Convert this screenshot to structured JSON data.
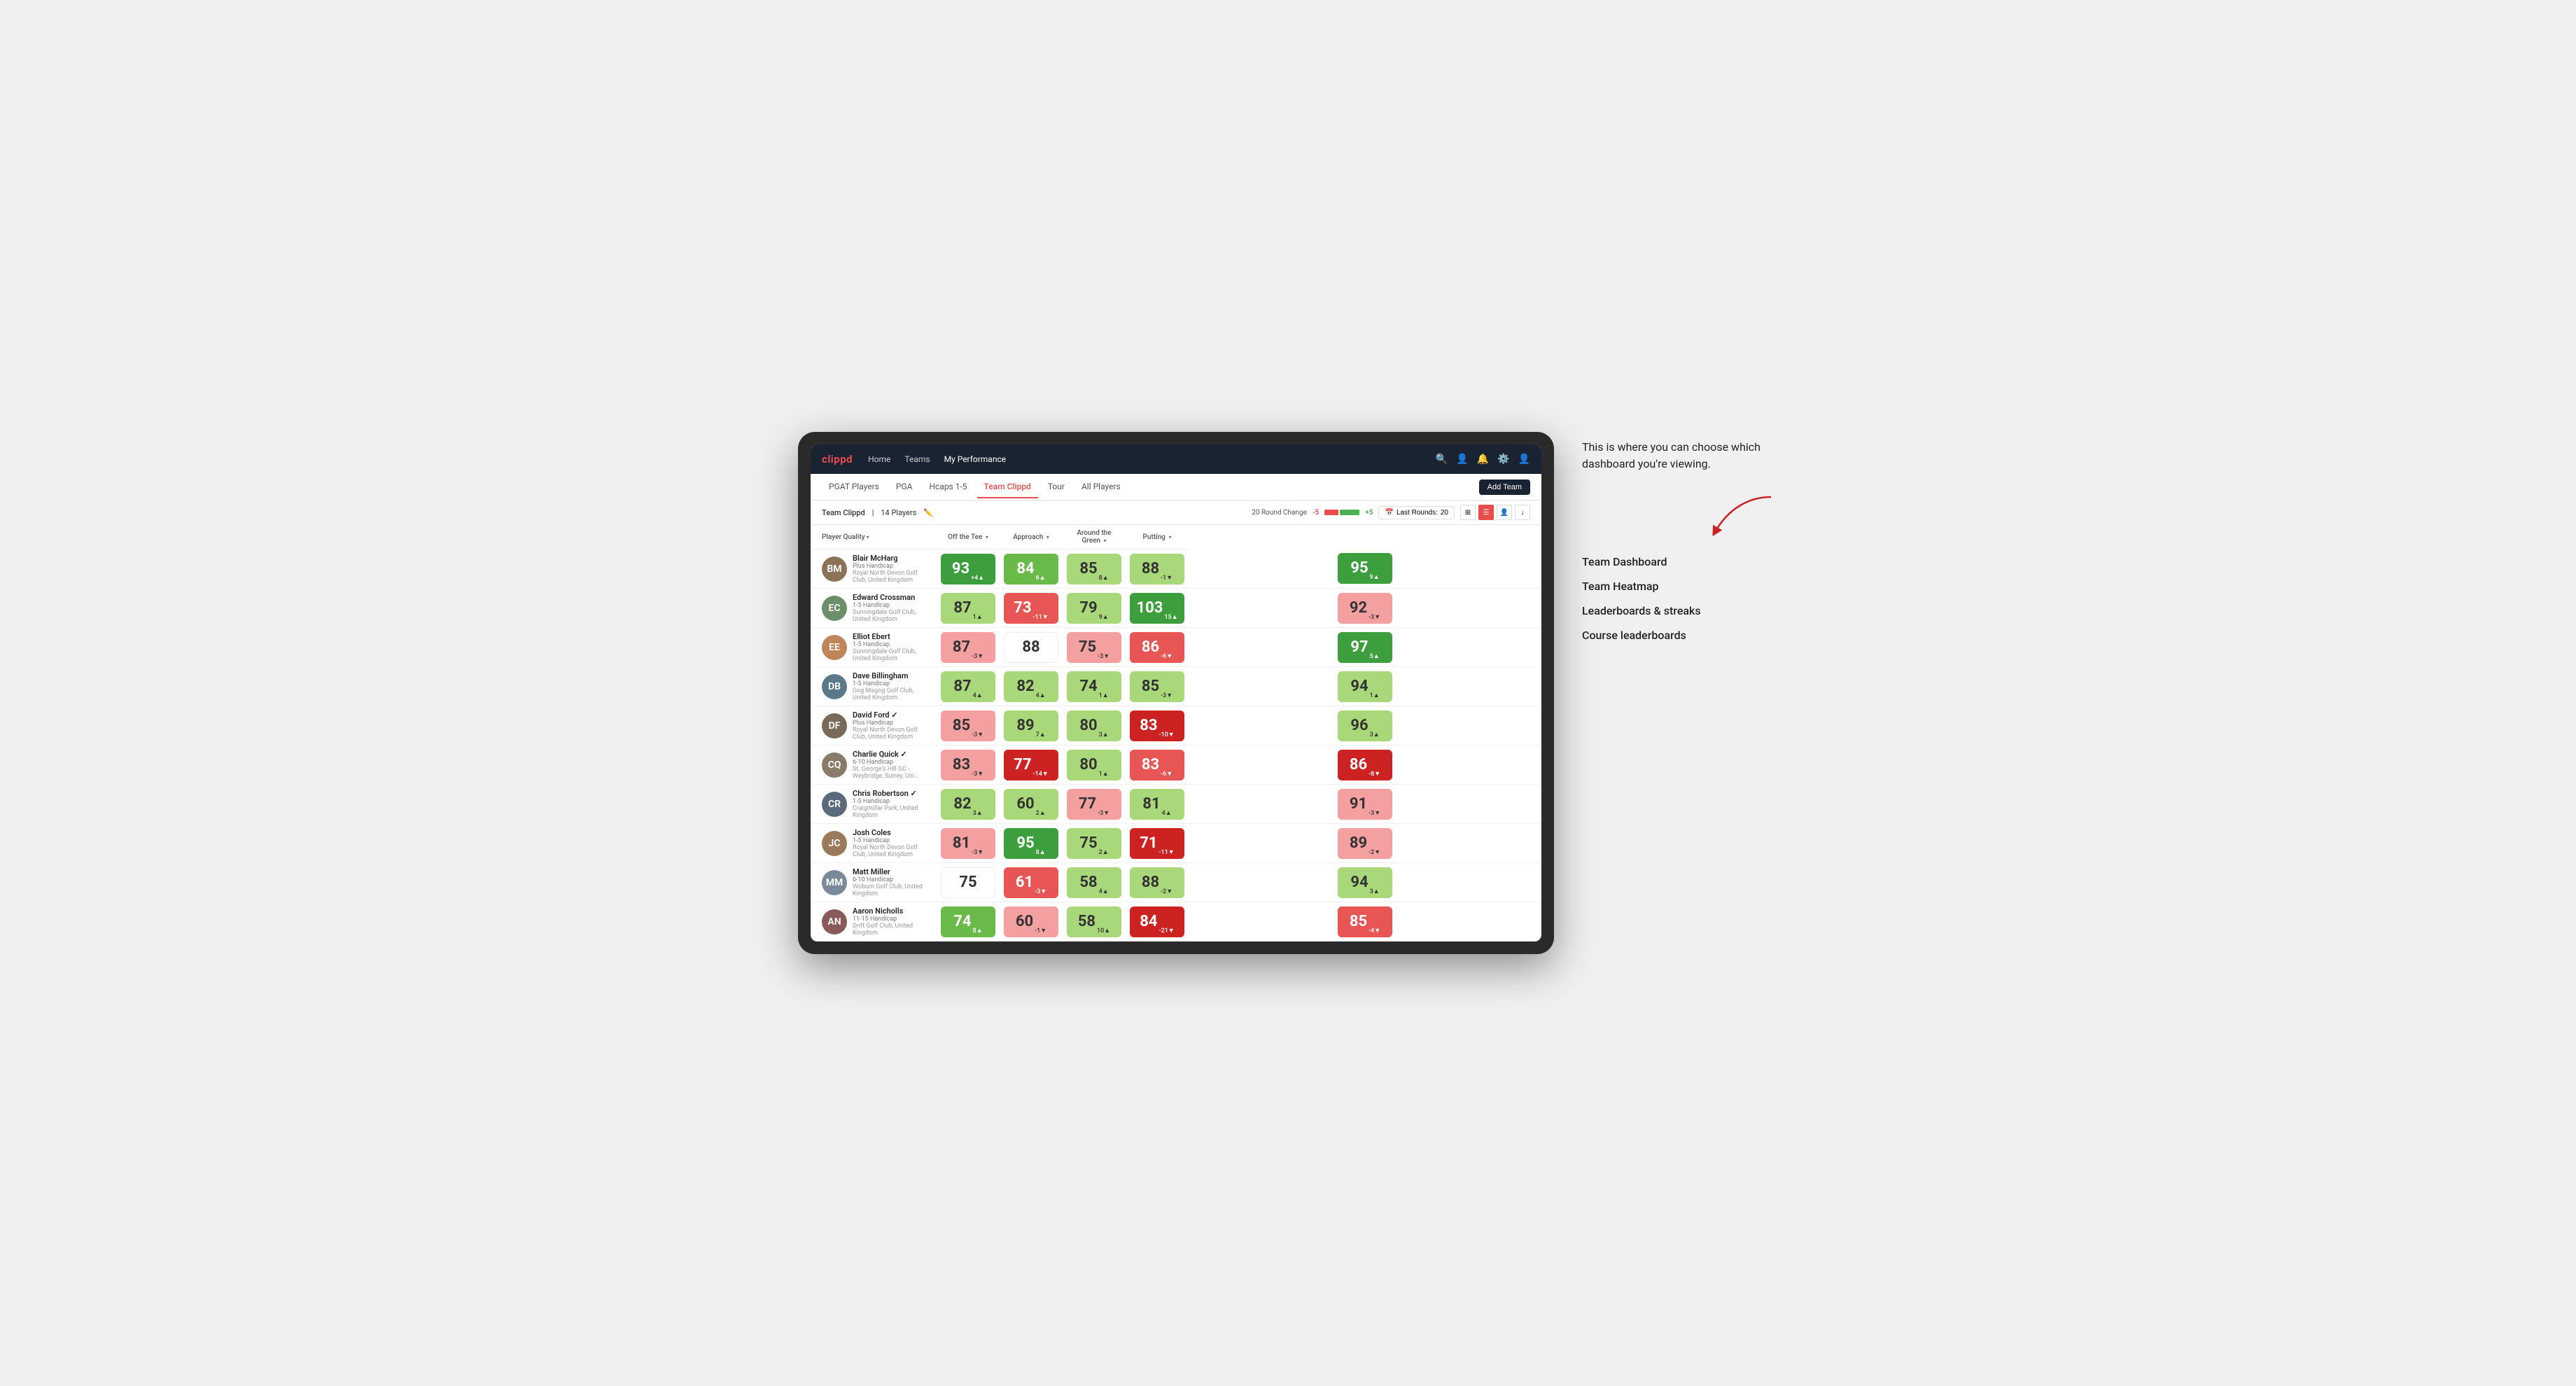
{
  "annotation": {
    "description": "This is where you can choose which dashboard you're viewing.",
    "options": [
      "Team Dashboard",
      "Team Heatmap",
      "Leaderboards & streaks",
      "Course leaderboards"
    ]
  },
  "nav": {
    "logo": "clippd",
    "links": [
      "Home",
      "Teams",
      "My Performance"
    ],
    "active_link": "My Performance"
  },
  "sub_nav": {
    "links": [
      "PGAT Players",
      "PGA",
      "Hcaps 1-5",
      "Team Clippd",
      "Tour",
      "All Players"
    ],
    "active": "Team Clippd",
    "add_team_label": "Add Team"
  },
  "team_header": {
    "name": "Team Clippd",
    "separator": "|",
    "player_count": "14 Players",
    "round_change_label": "20 Round Change",
    "change_minus": "-5",
    "change_plus": "+5",
    "last_rounds_label": "Last Rounds:",
    "last_rounds_value": "20"
  },
  "table": {
    "col_headers": [
      {
        "label": "Player Quality",
        "sortable": true
      },
      {
        "label": "Off the Tee",
        "sortable": true
      },
      {
        "label": "Approach",
        "sortable": true
      },
      {
        "label": "Around the Green",
        "sortable": true
      },
      {
        "label": "Putting",
        "sortable": true
      }
    ],
    "players": [
      {
        "name": "Blair McHarg",
        "handicap": "Plus Handicap",
        "club": "Royal North Devon Golf Club, United Kingdom",
        "avatar_color": "#8B7355",
        "initials": "BM",
        "scores": [
          {
            "value": 93,
            "change": "+4",
            "dir": "up",
            "color": "bg-green-dark"
          },
          {
            "value": 84,
            "change": "6",
            "dir": "up",
            "color": "bg-green-mid"
          },
          {
            "value": 85,
            "change": "8",
            "dir": "up",
            "color": "bg-green-light"
          },
          {
            "value": 88,
            "change": "-1",
            "dir": "down",
            "color": "bg-green-light"
          },
          {
            "value": 95,
            "change": "9",
            "dir": "up",
            "color": "bg-green-dark"
          }
        ]
      },
      {
        "name": "Edward Crossman",
        "handicap": "1-5 Handicap",
        "club": "Sunningdale Golf Club, United Kingdom",
        "avatar_color": "#6B8E6B",
        "initials": "EC",
        "scores": [
          {
            "value": 87,
            "change": "1",
            "dir": "up",
            "color": "bg-green-light"
          },
          {
            "value": 73,
            "change": "-11",
            "dir": "down",
            "color": "bg-red-mid"
          },
          {
            "value": 79,
            "change": "9",
            "dir": "up",
            "color": "bg-green-light"
          },
          {
            "value": 103,
            "change": "15",
            "dir": "up",
            "color": "bg-green-dark"
          },
          {
            "value": 92,
            "change": "-3",
            "dir": "down",
            "color": "bg-red-light"
          }
        ]
      },
      {
        "name": "Elliot Ebert",
        "handicap": "1-5 Handicap",
        "club": "Sunningdale Golf Club, United Kingdom",
        "avatar_color": "#c0855a",
        "initials": "EE",
        "scores": [
          {
            "value": 87,
            "change": "-3",
            "dir": "down",
            "color": "bg-red-light"
          },
          {
            "value": 88,
            "change": "",
            "dir": "",
            "color": "bg-white"
          },
          {
            "value": 75,
            "change": "-3",
            "dir": "down",
            "color": "bg-red-light"
          },
          {
            "value": 86,
            "change": "-6",
            "dir": "down",
            "color": "bg-red-mid"
          },
          {
            "value": 97,
            "change": "5",
            "dir": "up",
            "color": "bg-green-dark"
          }
        ]
      },
      {
        "name": "Dave Billingham",
        "handicap": "1-5 Handicap",
        "club": "Gog Magog Golf Club, United Kingdom",
        "avatar_color": "#5a7a8a",
        "initials": "DB",
        "scores": [
          {
            "value": 87,
            "change": "4",
            "dir": "up",
            "color": "bg-green-light"
          },
          {
            "value": 82,
            "change": "4",
            "dir": "up",
            "color": "bg-green-light"
          },
          {
            "value": 74,
            "change": "1",
            "dir": "up",
            "color": "bg-green-light"
          },
          {
            "value": 85,
            "change": "-3",
            "dir": "down",
            "color": "bg-green-light"
          },
          {
            "value": 94,
            "change": "1",
            "dir": "up",
            "color": "bg-green-light"
          }
        ]
      },
      {
        "name": "David Ford",
        "handicap": "Plus Handicap",
        "club": "Royal North Devon Golf Club, United Kingdom",
        "avatar_color": "#7a6a5a",
        "initials": "DF",
        "verified": true,
        "scores": [
          {
            "value": 85,
            "change": "-3",
            "dir": "down",
            "color": "bg-red-light"
          },
          {
            "value": 89,
            "change": "7",
            "dir": "up",
            "color": "bg-green-light"
          },
          {
            "value": 80,
            "change": "3",
            "dir": "up",
            "color": "bg-green-light"
          },
          {
            "value": 83,
            "change": "-10",
            "dir": "down",
            "color": "bg-red-dark"
          },
          {
            "value": 96,
            "change": "3",
            "dir": "up",
            "color": "bg-green-light"
          }
        ]
      },
      {
        "name": "Charlie Quick",
        "handicap": "6-10 Handicap",
        "club": "St. George's Hill GC - Weybridge, Surrey, Uni...",
        "avatar_color": "#8a7a6a",
        "initials": "CQ",
        "verified": true,
        "scores": [
          {
            "value": 83,
            "change": "-3",
            "dir": "down",
            "color": "bg-red-light"
          },
          {
            "value": 77,
            "change": "-14",
            "dir": "down",
            "color": "bg-red-dark"
          },
          {
            "value": 80,
            "change": "1",
            "dir": "up",
            "color": "bg-green-light"
          },
          {
            "value": 83,
            "change": "-6",
            "dir": "down",
            "color": "bg-red-mid"
          },
          {
            "value": 86,
            "change": "-8",
            "dir": "down",
            "color": "bg-red-dark"
          }
        ]
      },
      {
        "name": "Chris Robertson",
        "handicap": "1-5 Handicap",
        "club": "Craigmillar Park, United Kingdom",
        "avatar_color": "#5a6a7a",
        "initials": "CR",
        "verified": true,
        "scores": [
          {
            "value": 82,
            "change": "3",
            "dir": "up",
            "color": "bg-green-light"
          },
          {
            "value": 60,
            "change": "2",
            "dir": "up",
            "color": "bg-green-light"
          },
          {
            "value": 77,
            "change": "-3",
            "dir": "down",
            "color": "bg-red-light"
          },
          {
            "value": 81,
            "change": "4",
            "dir": "up",
            "color": "bg-green-light"
          },
          {
            "value": 91,
            "change": "-3",
            "dir": "down",
            "color": "bg-red-light"
          }
        ]
      },
      {
        "name": "Josh Coles",
        "handicap": "1-5 Handicap",
        "club": "Royal North Devon Golf Club, United Kingdom",
        "avatar_color": "#9a7a5a",
        "initials": "JC",
        "scores": [
          {
            "value": 81,
            "change": "-3",
            "dir": "down",
            "color": "bg-red-light"
          },
          {
            "value": 95,
            "change": "8",
            "dir": "up",
            "color": "bg-green-dark"
          },
          {
            "value": 75,
            "change": "2",
            "dir": "up",
            "color": "bg-green-light"
          },
          {
            "value": 71,
            "change": "-11",
            "dir": "down",
            "color": "bg-red-dark"
          },
          {
            "value": 89,
            "change": "-2",
            "dir": "down",
            "color": "bg-red-light"
          }
        ]
      },
      {
        "name": "Matt Miller",
        "handicap": "6-10 Handicap",
        "club": "Woburn Golf Club, United Kingdom",
        "avatar_color": "#7a8a9a",
        "initials": "MM",
        "scores": [
          {
            "value": 75,
            "change": "",
            "dir": "",
            "color": "bg-white"
          },
          {
            "value": 61,
            "change": "-3",
            "dir": "down",
            "color": "bg-red-mid"
          },
          {
            "value": 58,
            "change": "4",
            "dir": "up",
            "color": "bg-green-light"
          },
          {
            "value": 88,
            "change": "-2",
            "dir": "down",
            "color": "bg-green-light"
          },
          {
            "value": 94,
            "change": "3",
            "dir": "up",
            "color": "bg-green-light"
          }
        ]
      },
      {
        "name": "Aaron Nicholls",
        "handicap": "11-15 Handicap",
        "club": "Drift Golf Club, United Kingdom",
        "avatar_color": "#8a5a5a",
        "initials": "AN",
        "scores": [
          {
            "value": 74,
            "change": "8",
            "dir": "up",
            "color": "bg-green-mid"
          },
          {
            "value": 60,
            "change": "-1",
            "dir": "down",
            "color": "bg-red-light"
          },
          {
            "value": 58,
            "change": "10",
            "dir": "up",
            "color": "bg-green-light"
          },
          {
            "value": 84,
            "change": "-21",
            "dir": "down",
            "color": "bg-red-dark"
          },
          {
            "value": 85,
            "change": "-4",
            "dir": "down",
            "color": "bg-red-mid"
          }
        ]
      }
    ]
  }
}
